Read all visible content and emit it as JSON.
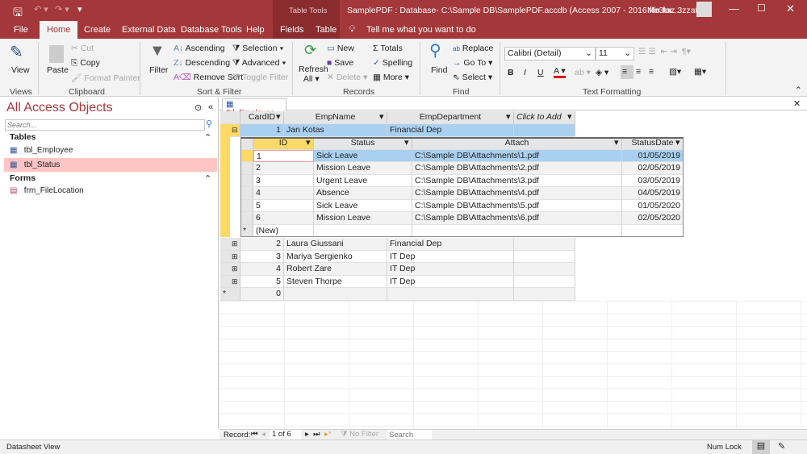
{
  "title": {
    "context_tab": "Table Tools",
    "window_title": "SamplePDF : Database- C:\\Sample DB\\SamplePDF.accdb (Access 2007 - 2016 file for...",
    "user": "Mo3taz 3zzat"
  },
  "tabs": [
    "File",
    "Home",
    "Create",
    "External Data",
    "Database Tools",
    "Help",
    "Fields",
    "Table"
  ],
  "tell_me": "Tell me what you want to do",
  "ribbon": {
    "views": {
      "view": "View",
      "group": "Views"
    },
    "clipboard": {
      "paste": "Paste",
      "cut": "Cut",
      "copy": "Copy",
      "format_painter": "Format Painter",
      "group": "Clipboard"
    },
    "sort_filter": {
      "filter": "Filter",
      "ascending": "Ascending",
      "descending": "Descending",
      "remove_sort": "Remove Sort",
      "selection": "Selection",
      "advanced": "Advanced",
      "toggle_filter": "Toggle Filter",
      "group": "Sort & Filter"
    },
    "records": {
      "refresh": "Refresh",
      "refresh_all": "All",
      "new": "New",
      "save": "Save",
      "delete": "Delete",
      "totals": "Totals",
      "spelling": "Spelling",
      "more": "More",
      "group": "Records"
    },
    "find": {
      "find": "Find",
      "replace": "Replace",
      "goto": "Go To",
      "select": "Select",
      "group": "Find"
    },
    "text_formatting": {
      "font": "Calibri (Detail)",
      "size": "11",
      "bold": "B",
      "italic": "I",
      "underline": "U",
      "group": "Text Formatting"
    }
  },
  "nav": {
    "title": "All Access Objects",
    "search_placeholder": "Search...",
    "sections": [
      {
        "label": "Tables",
        "items": [
          "tbl_Employee",
          "tbl_Status"
        ]
      },
      {
        "label": "Forms",
        "items": [
          "frm_FileLocation"
        ]
      }
    ],
    "selected": "tbl_Status"
  },
  "document": {
    "tab": "tbl_Employee",
    "columns": [
      "CardID",
      "EmpName",
      "EmpDepartment",
      "Click to Add"
    ],
    "rows": [
      [
        "1",
        "Jan Kotas",
        "Financial Dep"
      ],
      [
        "2",
        "Laura Giussani",
        "Financial Dep"
      ],
      [
        "3",
        "Mariya Sergienko",
        "IT Dep"
      ],
      [
        "4",
        "Robert Zare",
        "IT Dep"
      ],
      [
        "5",
        "Steven Thorpe",
        "IT Dep"
      ]
    ],
    "new_row_value": "0",
    "sub": {
      "columns": [
        "ID",
        "Status",
        "Attach",
        "StatusDate"
      ],
      "rows": [
        [
          "1",
          "Sick Leave",
          "C:\\Sample DB\\Attachments\\1.pdf",
          "01/05/2019"
        ],
        [
          "2",
          "Mission Leave",
          "C:\\Sample DB\\Attachments\\2.pdf",
          "02/05/2019"
        ],
        [
          "3",
          "Urgent Leave",
          "C:\\Sample DB\\Attachments\\3.pdf",
          "03/05/2019"
        ],
        [
          "4",
          "Absence",
          "C:\\Sample DB\\Attachments\\4.pdf",
          "04/05/2019"
        ],
        [
          "5",
          "Sick Leave",
          "C:\\Sample DB\\Attachments\\5.pdf",
          "01/05/2020"
        ],
        [
          "6",
          "Mission Leave",
          "C:\\Sample DB\\Attachments\\6.pdf",
          "02/05/2020"
        ]
      ],
      "new_label": "(New)"
    }
  },
  "record_nav": {
    "label": "Record:",
    "position": "1 of 6",
    "filter": "No Filter",
    "search": "Search"
  },
  "statusbar": {
    "left": "Datasheet View",
    "num_lock": "Num Lock"
  },
  "colors": {
    "accent": "#a4373a",
    "selected_row": "#a9d0f0",
    "record_selector": "#ffd966",
    "nav_selected": "#ffc4c4"
  }
}
